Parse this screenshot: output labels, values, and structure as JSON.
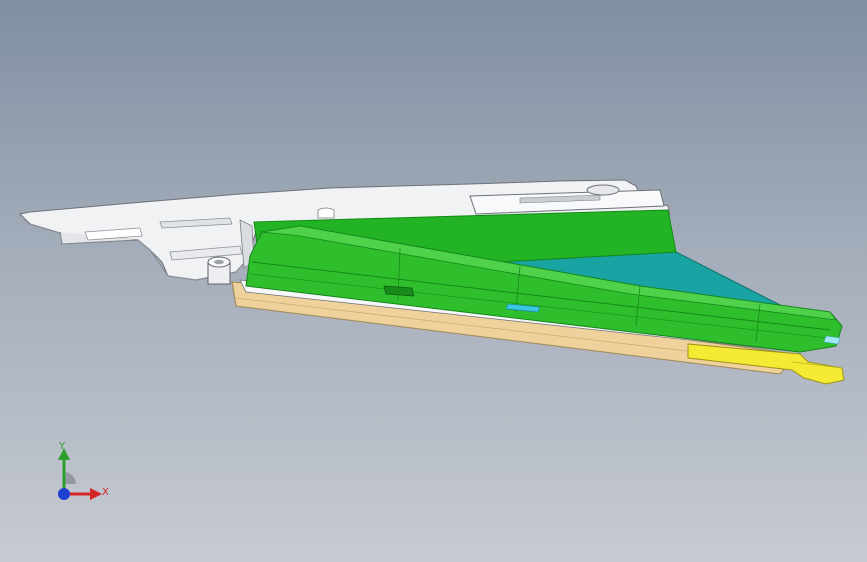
{
  "viewport": {
    "triad": {
      "y_label": "Y",
      "x_label": "X"
    },
    "colors": {
      "background_top": "#7f8fa2",
      "background_bottom": "#c7cbd1",
      "housing": "#f1f2f4",
      "green_panel": "#22b425",
      "green_dark": "#178a19",
      "teal_panel": "#19a3a3",
      "base_tan": "#efd29b",
      "clip_yellow": "#f4ea34",
      "axis_x": "#d62728",
      "axis_y": "#2ca02c",
      "axis_z": "#1f3fd1"
    }
  }
}
